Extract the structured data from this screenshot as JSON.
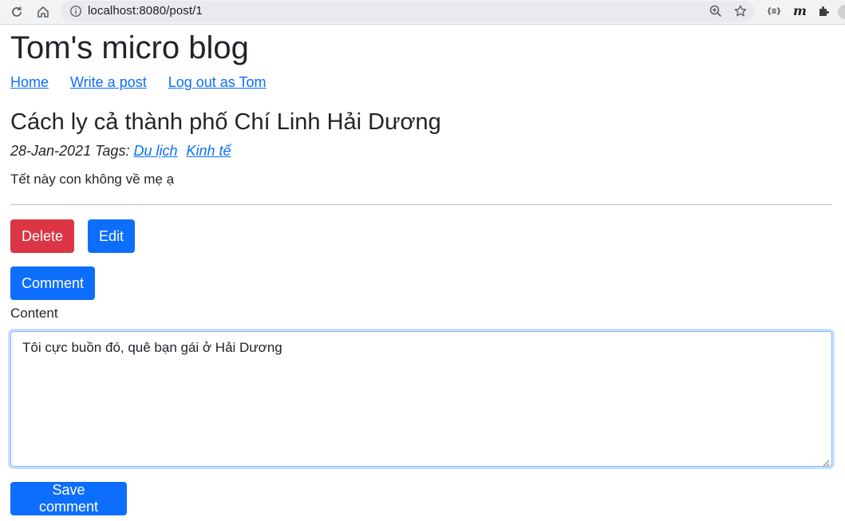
{
  "browser": {
    "url": "localhost:8080/post/1",
    "extension_json_label": "{≡}",
    "extension_m_label": "m"
  },
  "site": {
    "title": "Tom's micro blog"
  },
  "nav": {
    "home": "Home",
    "write": "Write a post",
    "logout": "Log out as Tom"
  },
  "post": {
    "title": "Cách ly cả thành phố Chí Linh Hải Dương",
    "date_tags_prefix": "28-Jan-2021 Tags:",
    "tags": [
      "Du lịch",
      "Kinh tế"
    ],
    "body": "Tết này con không về mẹ ạ"
  },
  "actions": {
    "delete": "Delete",
    "edit": "Edit",
    "comment": "Comment"
  },
  "comment_form": {
    "label": "Content",
    "value": "Tôi cực buồn đó, quê bạn gái ở Hải Dương",
    "save": "Save comment"
  },
  "colors": {
    "primary": "#0d6efd",
    "danger": "#dc3545",
    "link": "#0d6efd"
  }
}
